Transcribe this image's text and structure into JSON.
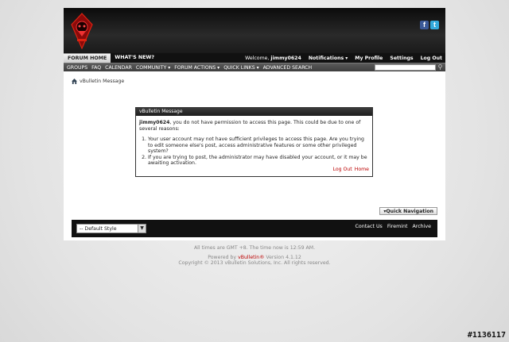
{
  "header": {
    "social": [
      {
        "name": "facebook-icon",
        "glyph": "f"
      },
      {
        "name": "twitter-icon",
        "glyph": "t"
      }
    ]
  },
  "navbar": {
    "tabs": [
      "FORUM HOME",
      "WHAT'S NEW?"
    ],
    "welcome": "Welcome,",
    "username": "jimmy0624",
    "links": [
      "Notifications",
      "My Profile",
      "Settings",
      "Log Out"
    ]
  },
  "subnav": {
    "items": [
      "GROUPS",
      "FAQ",
      "CALENDAR",
      "COMMUNITY",
      "FORUM ACTIONS",
      "QUICK LINKS",
      "ADVANCED SEARCH"
    ],
    "search_placeholder": ""
  },
  "breadcrumb": {
    "label": "vBulletin Message"
  },
  "message": {
    "title": "vBulletin Message",
    "username": "jimmy0624",
    "intro": ", you do not have permission to access this page. This could be due to one of several reasons:",
    "reasons": [
      "Your user account may not have sufficient privileges to access this page. Are you trying to edit someone else's post, access administrative features or some other privileged system?",
      "If you are trying to post, the administrator may have disabled your account, or it may be awaiting activation."
    ],
    "link_logout": "Log Out",
    "link_home": "Home"
  },
  "quicknav": {
    "label": "Quick Navigation"
  },
  "footer": {
    "style_select": "-- Default Style",
    "links": [
      "Contact Us",
      "Firemint",
      "Archive"
    ]
  },
  "below": {
    "time": "All times are GMT +8. The time now is 12:59 AM.",
    "powered_prefix": "Powered by ",
    "powered_brand": "vBulletin®",
    "powered_version": " Version 4.1.12",
    "copyright": "Copyright © 2013 vBulletin Solutions, Inc. All rights reserved."
  },
  "watermark": "#1136117",
  "colors": {
    "accent": "#b00000",
    "navbar": "#111111"
  }
}
